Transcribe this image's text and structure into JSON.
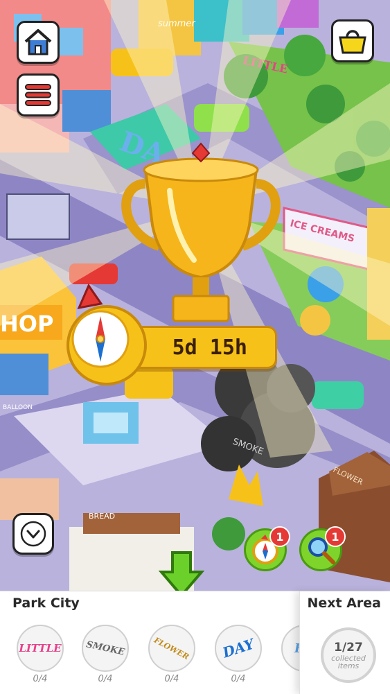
{
  "scene": {
    "signs": {
      "summer": "summer",
      "little": "LITTLE",
      "ice_creams": "ICE CREAMS",
      "shop": "HOP",
      "balloon": "BALLOON",
      "bread": "BREAD",
      "flower": "FLOWER",
      "smoke": "SMOKE",
      "day": "DA"
    }
  },
  "event": {
    "timer": "5d 15h"
  },
  "tools": {
    "compass_count": "1",
    "magnifier_count": "1"
  },
  "bottom_panel": {
    "area_name": "Park City",
    "next_area_label": "Next Area",
    "collected": "1/27",
    "collected_sub": "collected items",
    "collections": [
      {
        "word": "LITTLE",
        "count": "0/4",
        "color": "#e8408a"
      },
      {
        "word": "SMOKE",
        "count": "0/4",
        "color": "#666666"
      },
      {
        "word": "FLOWER",
        "count": "0/4",
        "color": "#c28a1a"
      },
      {
        "word": "DAY",
        "count": "0/4",
        "color": "#1b6fd1"
      },
      {
        "word": "BR",
        "count": "",
        "color": "#5aa0e0"
      }
    ]
  },
  "icons": {
    "home": "home-icon",
    "menu": "hamburger-menu-icon",
    "shop": "shopping-bag-icon",
    "collapse": "chevron-down-icon",
    "arrow": "arrow-down-icon",
    "trophy": "trophy-icon",
    "compass": "compass-icon",
    "magnifier": "magnifier-icon"
  },
  "colors": {
    "tool_green": "#7ed42b",
    "badge_red": "#e53935",
    "timer_gold": "#f6c21a"
  }
}
